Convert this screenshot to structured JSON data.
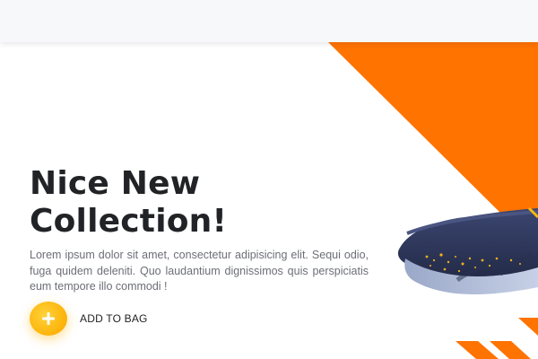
{
  "hero": {
    "title_line1": "Nice New",
    "title_line2": "Collection!",
    "description": "Lorem ipsum dolor sit amet, consectetur adipisicing elit. Sequi odio, fuga quidem deleniti. Quo laudantium dignissimos quis perspiciatis eum tempore illo commodi !",
    "cta_label": "ADD TO BAG"
  },
  "icons": {
    "cta_icon": "plus-icon",
    "product_image": "sneaker-image"
  },
  "colors": {
    "accent_orange": "#ff7300",
    "cta_yellow": "#fdb70f",
    "title_text": "#222326",
    "body_text": "#6c6f76",
    "topbar_bg": "#f7f8fa"
  }
}
